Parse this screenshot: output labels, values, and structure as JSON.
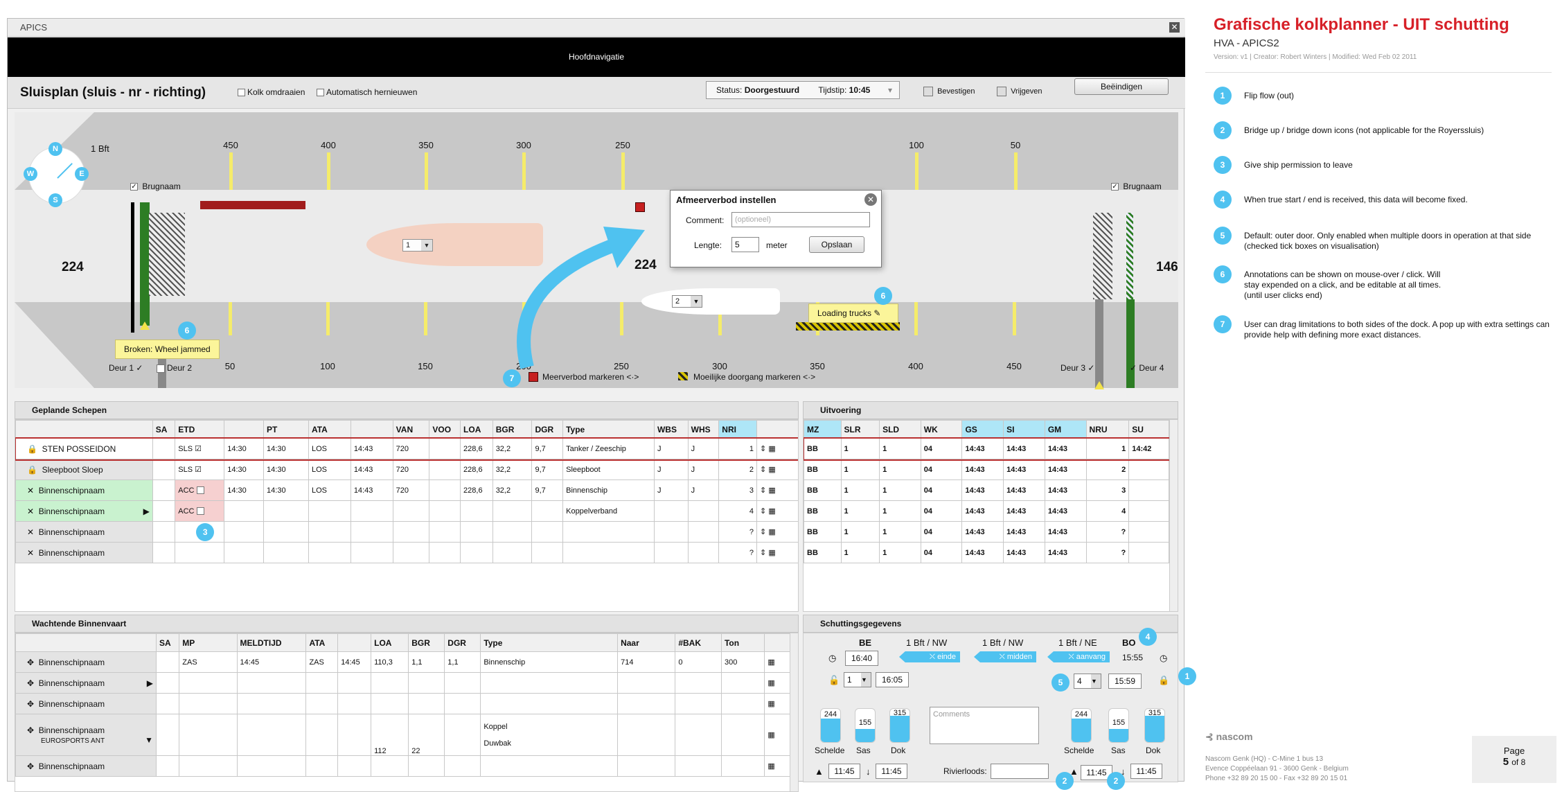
{
  "window": {
    "title": "APICS",
    "nav_title": "Hoofdnavigatie"
  },
  "toolbar": {
    "page_title": "Sluisplan (sluis - nr - richting)",
    "kolk_omdraaien": "Kolk omdraaien",
    "auto_renew": "Automatisch hernieuwen",
    "status_label": "Status:",
    "status_value": "Doorgestuurd",
    "tijdstip_label": "Tijdstip:",
    "tijdstip_value": "10:45",
    "bevestigen": "Bevestigen",
    "vrijgeven": "Vrijgeven",
    "beeindigen": "Beëindigen"
  },
  "plan": {
    "wind": "1 Bft",
    "compass": [
      "N",
      "E",
      "S",
      "W"
    ],
    "brugnaam_left": "Brugnaam",
    "brugnaam_right": "Brugnaam",
    "top_ticks": [
      "450",
      "400",
      "350",
      "300",
      "250",
      "100",
      "50"
    ],
    "bottom_ticks": [
      "50",
      "100",
      "150",
      "200",
      "250",
      "300",
      "350",
      "400",
      "450"
    ],
    "left_num": "224",
    "center_num": "224",
    "right_num": "146",
    "ship1_select": "1",
    "ship2_select": "2",
    "popup": {
      "title": "Afmeerverbod instellen",
      "comment_label": "Comment:",
      "comment_placeholder": "(optioneel)",
      "length_label": "Lengte:",
      "length_value": "5",
      "unit": "meter",
      "save": "Opslaan"
    },
    "tip_broken": "Broken: Wheel jammed",
    "tip_trucks": "Loading trucks",
    "deur1": "Deur 1",
    "deur2": "Deur 2",
    "deur3": "Deur 3",
    "deur4": "Deur 4",
    "meerverbod": "Meerverbod markeren",
    "moeilijke": "Moeilijke doorgang markeren",
    "callouts": {
      "c6a": "6",
      "c6b": "6",
      "c7": "7"
    }
  },
  "geplande": {
    "title": "Geplande Schepen",
    "columns": [
      "SA",
      "ETD",
      "",
      "PT",
      "ATA",
      "",
      "VAN",
      "VOO",
      "LOA",
      "BGR",
      "DGR",
      "Type",
      "WBS",
      "WHS",
      "NRI"
    ],
    "rows": [
      {
        "name": "STEN POSSEIDON",
        "lead": "lock",
        "sa": "SLS",
        "t1": "14:30",
        "t2": "14:30",
        "ata": "LOS",
        "t3": "14:43",
        "van": "720",
        "loa": "228,6",
        "bgr": "32,2",
        "dgr": "9,7",
        "type": "Tanker / Zeeschip",
        "wbs": "J",
        "whs": "J",
        "nri": "1"
      },
      {
        "name": "Sleepboot Sloep",
        "lead": "lock",
        "sa": "SLS",
        "t1": "14:30",
        "t2": "14:30",
        "ata": "LOS",
        "t3": "14:43",
        "van": "720",
        "loa": "228,6",
        "bgr": "32,2",
        "dgr": "9,7",
        "type": "Sleepboot",
        "wbs": "J",
        "whs": "J",
        "nri": "2"
      },
      {
        "name": "Binnenschipnaam",
        "lead": "x",
        "sa": "ACC",
        "t1": "14:30",
        "t2": "14:30",
        "ata": "LOS",
        "t3": "14:43",
        "van": "720",
        "loa": "228,6",
        "bgr": "32,2",
        "dgr": "9,7",
        "type": "Binnenschip",
        "wbs": "J",
        "whs": "J",
        "nri": "3"
      },
      {
        "name": "Binnenschipnaam",
        "lead": "x",
        "sa": "ACC",
        "t1": "",
        "t2": "",
        "ata": "",
        "t3": "",
        "van": "",
        "loa": "",
        "bgr": "",
        "dgr": "",
        "type": "Koppelverband",
        "wbs": "",
        "whs": "",
        "nri": "4"
      },
      {
        "name": "Binnenschipnaam",
        "lead": "x",
        "sa": "",
        "t1": "",
        "t2": "",
        "ata": "",
        "t3": "",
        "van": "",
        "loa": "",
        "bgr": "",
        "dgr": "",
        "type": "",
        "wbs": "",
        "whs": "",
        "nri": "?"
      },
      {
        "name": "Binnenschipnaam",
        "lead": "x",
        "sa": "",
        "t1": "",
        "t2": "",
        "ata": "",
        "t3": "",
        "van": "",
        "loa": "",
        "bgr": "",
        "dgr": "",
        "type": "",
        "wbs": "",
        "whs": "",
        "nri": "?"
      }
    ],
    "callout3": "3"
  },
  "uitvoering": {
    "title": "Uitvoering",
    "columns": [
      "MZ",
      "SLR",
      "SLD",
      "WK",
      "GS",
      "SI",
      "GM",
      "NRU",
      "SU"
    ],
    "rows": [
      [
        "BB",
        "1",
        "1",
        "04",
        "14:43",
        "14:43",
        "14:43",
        "1",
        "14:42"
      ],
      [
        "BB",
        "1",
        "1",
        "04",
        "14:43",
        "14:43",
        "14:43",
        "2",
        ""
      ],
      [
        "BB",
        "1",
        "1",
        "04",
        "14:43",
        "14:43",
        "14:43",
        "3",
        ""
      ],
      [
        "BB",
        "1",
        "1",
        "04",
        "14:43",
        "14:43",
        "14:43",
        "4",
        ""
      ],
      [
        "BB",
        "1",
        "1",
        "04",
        "14:43",
        "14:43",
        "14:43",
        "?",
        ""
      ],
      [
        "BB",
        "1",
        "1",
        "04",
        "14:43",
        "14:43",
        "14:43",
        "?",
        ""
      ]
    ]
  },
  "wachtende": {
    "title": "Wachtende Binnenvaart",
    "columns": [
      "SA",
      "MP",
      "MELDTIJD",
      "ATA",
      "",
      "LOA",
      "BGR",
      "DGR",
      "Type",
      "Naar",
      "#BAK",
      "Ton"
    ],
    "rows": [
      {
        "name": "Binnenschipnaam",
        "mp": "ZAS",
        "meld": "14:45",
        "ata": "ZAS",
        "t": "14:45",
        "loa": "110,3",
        "bgr": "1,1",
        "dgr": "1,1",
        "type": "Binnenschip",
        "naar": "714",
        "bak": "0",
        "ton": "300"
      },
      {
        "name": "Binnenschipnaam",
        "mp": "",
        "meld": "",
        "ata": "",
        "t": "",
        "loa": "",
        "bgr": "",
        "dgr": "",
        "type": "",
        "naar": "",
        "bak": "",
        "ton": ""
      },
      {
        "name": "Binnenschipnaam",
        "mp": "",
        "meld": "",
        "ata": "",
        "t": "",
        "loa": "",
        "bgr": "",
        "dgr": "",
        "type": "",
        "naar": "",
        "bak": "",
        "ton": ""
      }
    ],
    "group": {
      "name": "Binnenschipnaam",
      "sub": "EUROSPORTS ANT",
      "type1": "Koppel",
      "loa": "112",
      "bgr": "22",
      "type2": "Duwbak"
    },
    "last": "Binnenschipnaam"
  },
  "schutting": {
    "title": "Schuttingsgegevens",
    "be": "BE",
    "bo": "BO",
    "bft1": "1 Bft / NW",
    "bft2": "1 Bft / NW",
    "bft3": "1 Bft / NE",
    "einde": "einde",
    "midden": "midden",
    "aanvang": "aanvang",
    "time1": "16:40",
    "time_bo": "15:55",
    "sel1": "1",
    "time2": "16:05",
    "sel4": "4",
    "time3": "15:59",
    "left_levels": {
      "a": "244",
      "b": "155",
      "c": "315"
    },
    "right_levels": {
      "a": "244",
      "b": "155",
      "c": "315"
    },
    "lvl_labels": [
      "Schelde",
      "Sas",
      "Dok"
    ],
    "comments_placeholder": "Comments",
    "rivierloods": "Rivierloods:",
    "t_a": "11:45",
    "t_b": "11:45",
    "t_c": "11:45",
    "t_d": "11:45",
    "callouts": {
      "c4": "4",
      "c5": "5",
      "c1": "1",
      "c2a": "2",
      "c2b": "2"
    }
  },
  "doc": {
    "title": "Grafische kolkplanner - UIT schutting",
    "subtitle": "HVA - APICS2",
    "meta": "Version: v1  |  Creator: Robert Winters  |  Modified: Wed Feb 02 2011",
    "notes": [
      {
        "num": "1",
        "text": "Flip flow  (out)"
      },
      {
        "num": "2",
        "text": "Bridge up / bridge down icons (not applicable for the Royerssluis)"
      },
      {
        "num": "3",
        "text": "Give ship permission to leave"
      },
      {
        "num": "4",
        "text": "When true start / end is received, this data will become fixed."
      },
      {
        "num": "5",
        "text": "Default: outer door. Only enabled when multiple doors in operation at that side (checked tick boxes on visualisation)"
      },
      {
        "num": "6",
        "text": "Annotations can be shown on mouse-over / click. Will stay expended on a click, and be editable at all times. (until user clicks end)"
      },
      {
        "num": "7",
        "text": "User can drag limitations to both sides of the dock. A pop up with extra settings can provide help with defining more exact distances."
      }
    ],
    "logo": "nascom",
    "address1": "Nascom Genk (HQ)   -   C-Mine 1 bus 13",
    "address2": "Evence Coppéelaan 91 - 3600 Genk  -  Belgium",
    "address3": "Phone +32 89 20 15 00  -  Fax +32 89 20 15 01",
    "page_label": "Page",
    "page_num": "5",
    "page_of": "of 8"
  }
}
